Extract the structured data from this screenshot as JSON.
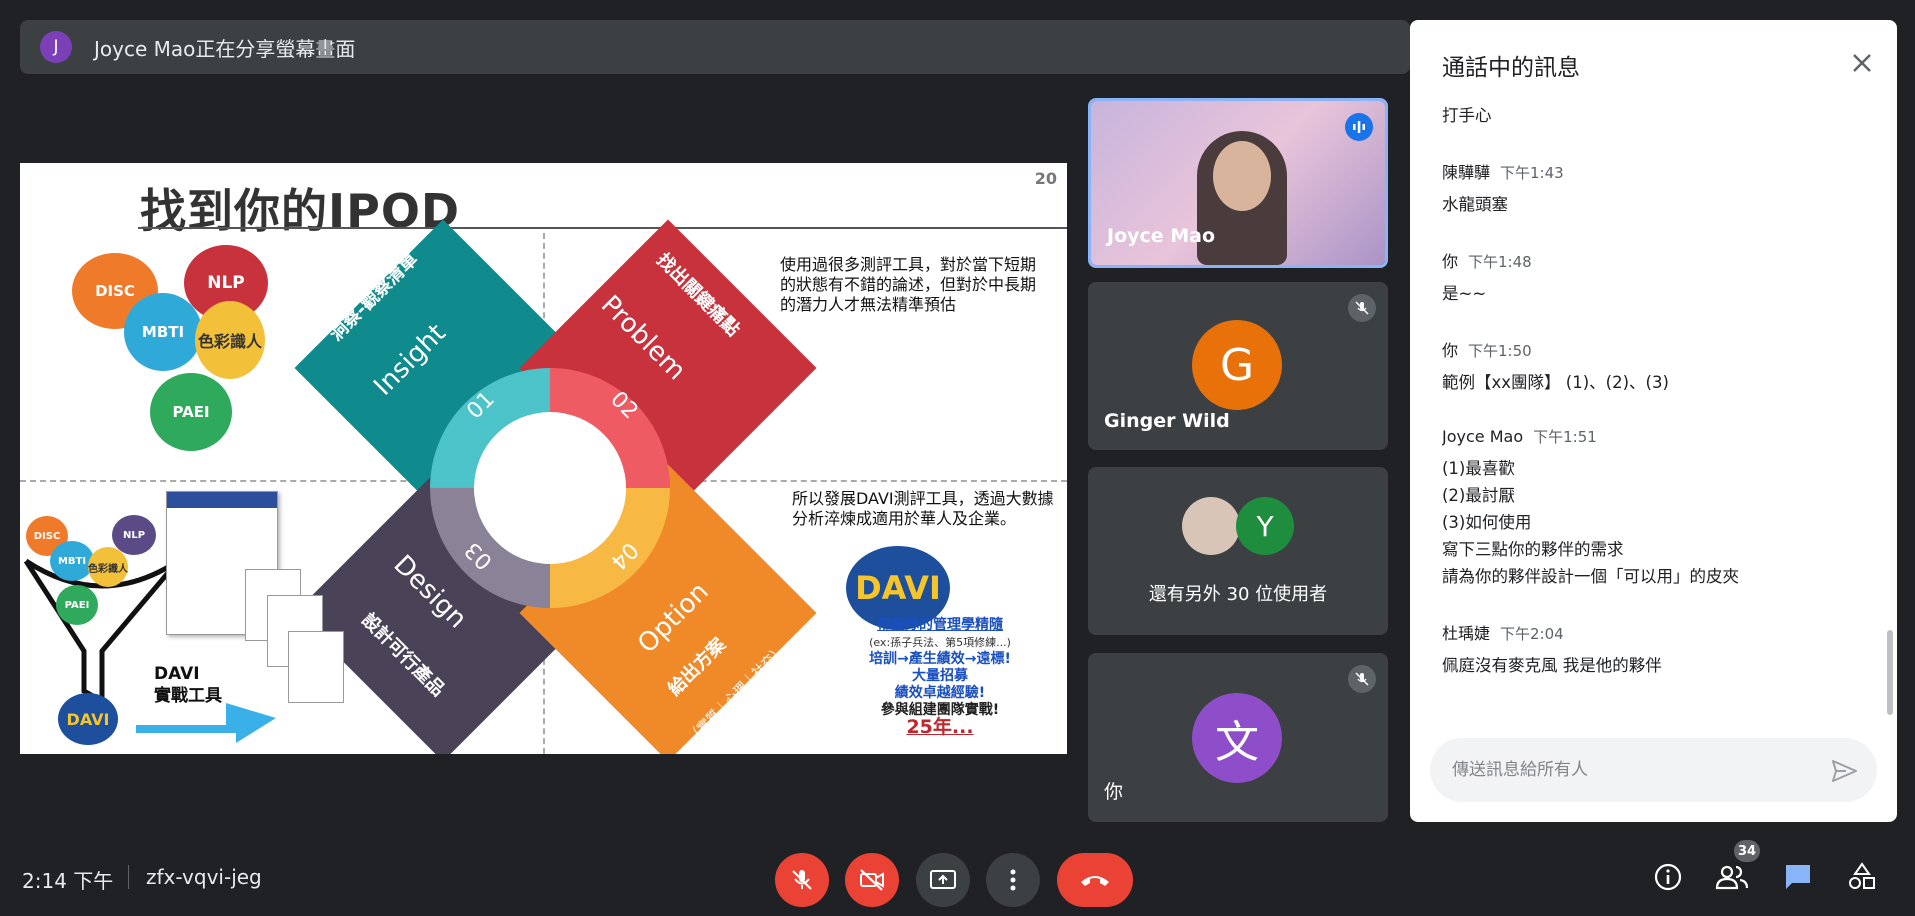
{
  "presenting": {
    "avatar_letter": "J",
    "text": "Joyce Mao正在分享螢幕畫面"
  },
  "slide": {
    "title": "找到你的IPOD",
    "number": "20",
    "circles": [
      "DISC",
      "NLP",
      "MBTI",
      "色彩識人",
      "PAEI"
    ],
    "petals": {
      "insight": {
        "title": "洞察-觀察清單",
        "en": "Insight",
        "num": "01"
      },
      "problem": {
        "title": "找出關鍵痛點",
        "en": "Problem",
        "num": "02"
      },
      "design": {
        "title": "設計可行產品",
        "en": "Design",
        "num": "03"
      },
      "option": {
        "title": "給出方案",
        "sub": "（實質｜心理｜社交）",
        "en": "Option",
        "num": "04"
      }
    },
    "text_top": [
      "使用過很多測評工具，對於當下短期",
      "的狀態有不錯的論述，但對於中長期",
      "的潛力人才無法精準預估"
    ],
    "text_bottom": [
      "所以發展DAVI測評工具，透過大數據",
      "分析淬煉成適用於華人及企業。"
    ],
    "davi_logo": "DAVI",
    "tool_label_1": "DAVI",
    "tool_label_2": "實戰工具",
    "blue_lines": [
      "帶團隊的管理學精隨",
      "(ex:孫子兵法、第5項修練...)",
      "培訓→產生績效→遠標!",
      "大量招募",
      "績效卓越經驗!",
      "參與組建團隊實戰!",
      "25年..."
    ]
  },
  "tiles": [
    {
      "name": "Joyce Mao",
      "type": "video",
      "speaking": true
    },
    {
      "name": "Ginger Wild",
      "initial": "G",
      "color": "#e8710a",
      "muted": true
    },
    {
      "name": "還有另外 30 位使用者",
      "initial": "Y",
      "color": "#1e8e3e"
    },
    {
      "name": "你",
      "initial": "文",
      "color": "#8e4dc9",
      "muted": true
    }
  ],
  "chat": {
    "title": "通話中的訊息",
    "messages": [
      {
        "sender": "",
        "time": "",
        "lines": [
          "打手心"
        ]
      },
      {
        "sender": "陳驊驊",
        "time": "下午1:43",
        "lines": [
          "水龍頭塞"
        ]
      },
      {
        "sender": "你",
        "time": "下午1:48",
        "lines": [
          "是~~"
        ]
      },
      {
        "sender": "你",
        "time": "下午1:50",
        "lines": [
          "範例【xx團隊】 (1)、(2)、(3)"
        ]
      },
      {
        "sender": "Joyce Mao",
        "time": "下午1:51",
        "lines": [
          "(1)最喜歡",
          "(2)最討厭",
          "(3)如何使用",
          "寫下三點你的夥伴的需求",
          "請為你的夥伴設計一個「可以用」的皮夾"
        ]
      },
      {
        "sender": "杜瑀婕",
        "time": "下午2:04",
        "lines": [
          "佩庭沒有麥克風 我是他的夥伴"
        ]
      }
    ],
    "input_placeholder": "傳送訊息給所有人"
  },
  "bottom": {
    "time": "2:14 下午",
    "meeting_code": "zfx-vqvi-jeg",
    "people_count": "34"
  },
  "colors": {
    "background": "#202124",
    "danger": "#ea4335",
    "accent": "#8ab4f8",
    "tile": "#3c4043"
  },
  "icons": [
    "mic-off-icon",
    "camera-off-icon",
    "present-icon",
    "more-icon",
    "end-call-icon",
    "info-icon",
    "people-icon",
    "chat-icon",
    "activities-icon",
    "close-icon",
    "send-icon",
    "speaking-icon"
  ]
}
